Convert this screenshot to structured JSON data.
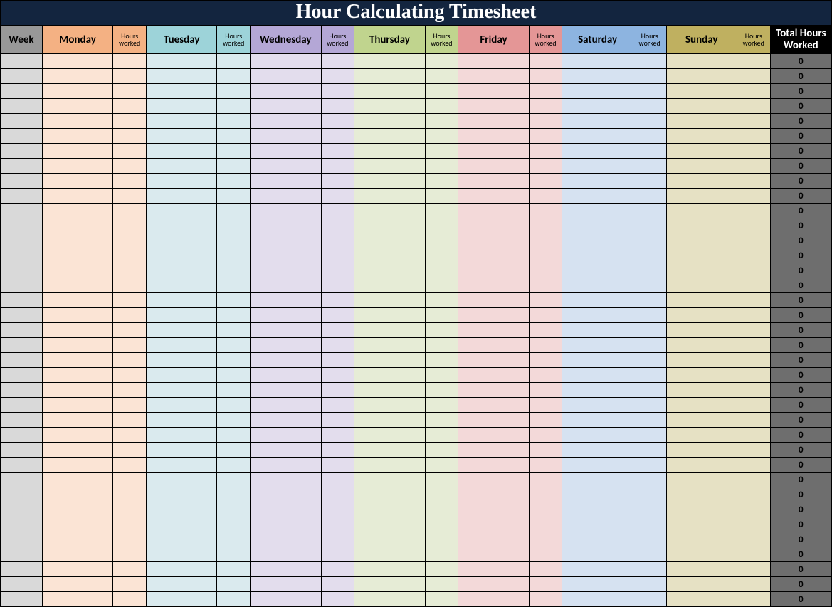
{
  "title": "Hour Calculating Timesheet",
  "headers": {
    "week": "Week",
    "days": [
      "Monday",
      "Tuesday",
      "Wednesday",
      "Thursday",
      "Friday",
      "Saturday",
      "Sunday"
    ],
    "hours_worked_label": "Hours worked",
    "total": "Total Hours Worked"
  },
  "row_count": 37,
  "default_total": "0",
  "colors": {
    "title_bg": "#13253f",
    "week_header": "#989898",
    "mon_header": "#f4b183",
    "tue_header": "#9dd3d9",
    "wed_header": "#b4a7d6",
    "thu_header": "#c0d48e",
    "fri_header": "#e49696",
    "sat_header": "#8db4e0",
    "sun_header": "#bfb060",
    "total_header": "#000000",
    "week_cell": "#d9d9d9",
    "mon_cell": "#fbe4d5",
    "tue_cell": "#daeaee",
    "wed_cell": "#e3dded",
    "thu_cell": "#e6ecd6",
    "fri_cell": "#f3d9d9",
    "sat_cell": "#d6e2f1",
    "sun_cell": "#e6e1c4",
    "total_cell": "#6e6e6e"
  }
}
